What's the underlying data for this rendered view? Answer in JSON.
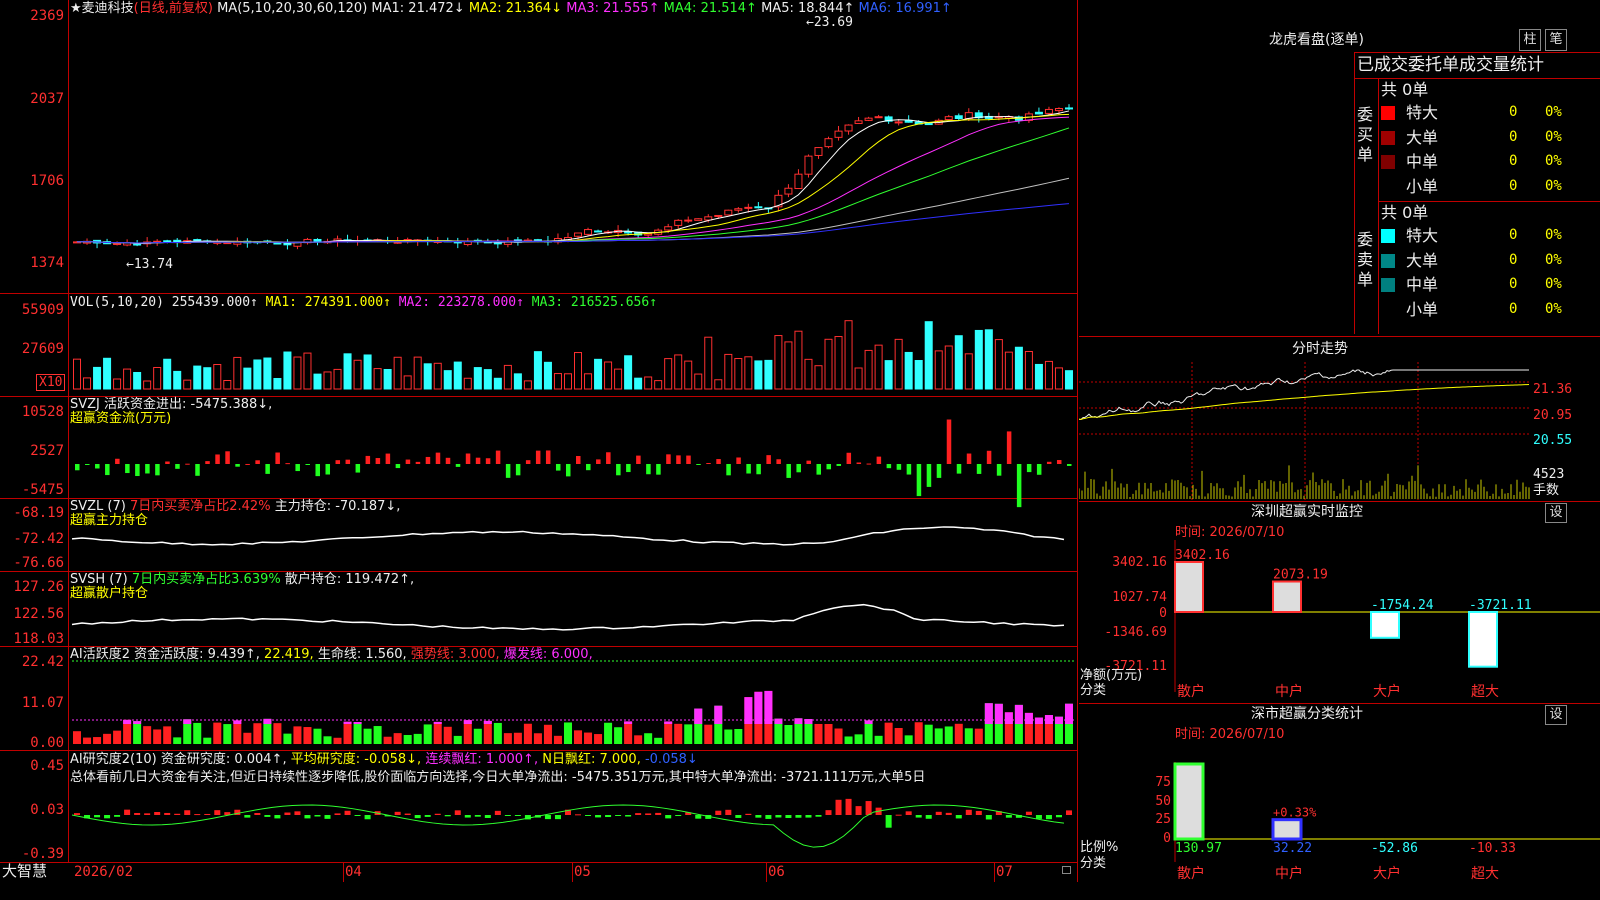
{
  "window": {
    "app_name": "大智慧"
  },
  "main": {
    "title": {
      "star": "★",
      "name": "麦迪科技",
      "period": "(日线,前复权)"
    },
    "ma_label": "MA(5,10,20,30,60,120)",
    "ma_values": [
      "MA1: 21.472↓",
      "MA2: 21.364↓",
      "MA3: 21.555↑",
      "MA4: 21.514↑",
      "MA5: 18.844↑",
      "MA6: 16.991↑"
    ],
    "y_ticks": [
      "2369",
      "2037",
      "1706",
      "1374"
    ],
    "high_label": "←23.69",
    "low_label": "←13.74"
  },
  "vol": {
    "label": "VOL(5,10,20)",
    "value": "255439.000↑",
    "ma": [
      "MA1: 274391.000↑",
      "MA2: 223278.000↑",
      "MA3: 216525.656↑"
    ],
    "y_ticks": [
      "55909",
      "27609"
    ],
    "unit": "X10"
  },
  "svzj": {
    "label": "SVZJ",
    "line1": "活跃资金进出: -5475.388↓,",
    "line2": "超赢资金流(万元)",
    "y_ticks": [
      "10528",
      "2527",
      "-5475"
    ]
  },
  "svzl": {
    "label": "SVZL (7)",
    "ratio": "7日内买卖净占比2.42%",
    "value": "主力持仓: -70.187↓,",
    "line2": "超赢主力持仓",
    "y_ticks": [
      "-68.19",
      "-72.42",
      "-76.66"
    ]
  },
  "svsh": {
    "label": "SVSH (7)",
    "ratio": "7日内买卖净占比3.639%",
    "value": "散户持仓: 119.472↑,",
    "line2": "超赢散户持仓",
    "y_ticks": [
      "127.26",
      "122.56",
      "118.03"
    ]
  },
  "ai_active": {
    "label": "AI活跃度2",
    "v1": "资金活跃度: 9.439↑,",
    "v2": "22.419,",
    "v3": "生命线: 1.560,",
    "v4": "强势线: 3.000,",
    "v5": "爆发线: 6.000,",
    "y_ticks": [
      "22.42",
      "11.07",
      "0.00"
    ]
  },
  "ai_research": {
    "label": "AI研究度2(10)",
    "v1": "资金研究度: 0.004↑,",
    "v2": "平均研究度: -0.058↓,",
    "v3": "连续飘红: 1.000↑,",
    "v4": "N日飘红: 7.000,",
    "v5": "-0.058↓",
    "summary": "总体看前几日大资金有关注,但近日持续性逐步降低,股价面临方向选择,今日大单净流出: -5475.351万元,其中特大单净流出: -3721.111万元,大单5日",
    "y_ticks": [
      "0.45",
      "0.03",
      "-0.39"
    ]
  },
  "x_axis": [
    "2026/02",
    "04",
    "05",
    "06",
    "07"
  ],
  "longhu": {
    "title": "龙虎看盘(逐单)",
    "btn1": "柱",
    "btn2": "笔",
    "header": "已成交委托单成交量统计",
    "buy_label": "委买单",
    "buy_total": "共 0单",
    "buy_rows": [
      {
        "name": "特大",
        "count": "0",
        "pct": "0%",
        "color": "#ff0000"
      },
      {
        "name": "大单",
        "count": "0",
        "pct": "0%",
        "color": "#a00000"
      },
      {
        "name": "中单",
        "count": "0",
        "pct": "0%",
        "color": "#800000"
      },
      {
        "name": "小单",
        "count": "0",
        "pct": "0%",
        "color": ""
      }
    ],
    "sell_label": "委卖单",
    "sell_total": "共 0单",
    "sell_rows": [
      {
        "name": "特大",
        "count": "0",
        "pct": "0%",
        "color": "#00ffff"
      },
      {
        "name": "大单",
        "count": "0",
        "pct": "0%",
        "color": "#008888"
      },
      {
        "name": "中单",
        "count": "0",
        "pct": "0%",
        "color": "#008080"
      },
      {
        "name": "小单",
        "count": "0",
        "pct": "0%",
        "color": ""
      }
    ]
  },
  "intraday": {
    "title": "分时走势",
    "prices": [
      "21.36",
      "20.95",
      "20.55"
    ],
    "volume": "4523",
    "vol_unit": "手数"
  },
  "shenzhen_monitor": {
    "title": "深圳超赢实时监控",
    "btn": "设",
    "date": "时间: 2026/07/10",
    "y_ticks": [
      "3402.16",
      "1027.74",
      "0",
      "-1346.69",
      "-3721.11"
    ],
    "bars": [
      {
        "name": "散户",
        "value": 3402.16,
        "label": "3402.16"
      },
      {
        "name": "中户",
        "value": 2073.19,
        "label": "2073.19"
      },
      {
        "name": "大户",
        "value": -1754.24,
        "label": "-1754.24"
      },
      {
        "name": "超大",
        "value": -3721.11,
        "label": "-3721.11"
      }
    ],
    "ylabel": "净额(万元)",
    "xlabel": "分类"
  },
  "shenzhen_class": {
    "title": "深市超赢分类统计",
    "btn": "设",
    "date": "时间: 2026/07/10",
    "y_ticks": [
      "75",
      "50",
      "25",
      "0"
    ],
    "bars": [
      {
        "name": "散户",
        "value": 130.97,
        "label": "130.97"
      },
      {
        "name": "中户",
        "value": 32.22,
        "label": "32.22",
        "top_label": "+0.33%"
      },
      {
        "name": "大户",
        "value": -52.86,
        "label": "-52.86"
      },
      {
        "name": "超大",
        "value": -10.33,
        "label": "-10.33"
      }
    ],
    "ylabel": "比例%",
    "xlabel": "分类"
  }
}
